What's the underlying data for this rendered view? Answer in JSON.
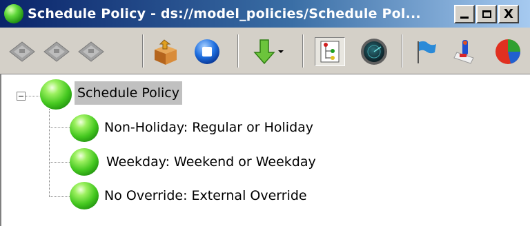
{
  "window": {
    "title": "Schedule Policy - ds://model_policies/Schedule Pol...",
    "title_icon": "green-ball-icon",
    "caption_buttons": [
      "minimize",
      "maximize",
      "close"
    ],
    "close_glyph": "X"
  },
  "toolbar": {
    "buttons": [
      {
        "name": "save",
        "icon": "gray-diskette-icon",
        "enabled": false
      },
      {
        "name": "save-all",
        "icon": "gray-diskette-icon",
        "enabled": false
      },
      {
        "name": "save-as",
        "icon": "gray-diskette-icon",
        "enabled": false
      },
      {
        "name": "open-package",
        "icon": "package-box-icon",
        "enabled": true
      },
      {
        "name": "stop",
        "icon": "blue-stop-icon",
        "enabled": true
      },
      {
        "name": "download",
        "icon": "green-down-arrow-icon",
        "enabled": true
      },
      {
        "name": "tree-view",
        "icon": "tree-structure-icon",
        "pressed": true
      },
      {
        "name": "radar",
        "icon": "radar-globe-icon",
        "enabled": true
      },
      {
        "name": "flag",
        "icon": "blue-flag-icon",
        "enabled": true
      },
      {
        "name": "tools",
        "icon": "tools-icon",
        "enabled": true
      },
      {
        "name": "pie-chart",
        "icon": "pie-chart-icon",
        "enabled": true
      }
    ]
  },
  "tree": {
    "root": {
      "label": "Schedule Policy",
      "expanded": true,
      "expander_glyph": "−"
    },
    "children": [
      {
        "label": "Non-Holiday: Regular or Holiday"
      },
      {
        "label": "Weekday: Weekend or Weekday"
      },
      {
        "label": "No Override: External Override"
      }
    ]
  },
  "colors": {
    "titlebar_start": "#0a246a",
    "titlebar_end": "#a6caf0",
    "chrome": "#d4d0c8",
    "selection": "#c0c0c0",
    "node_green": "#45c820"
  }
}
